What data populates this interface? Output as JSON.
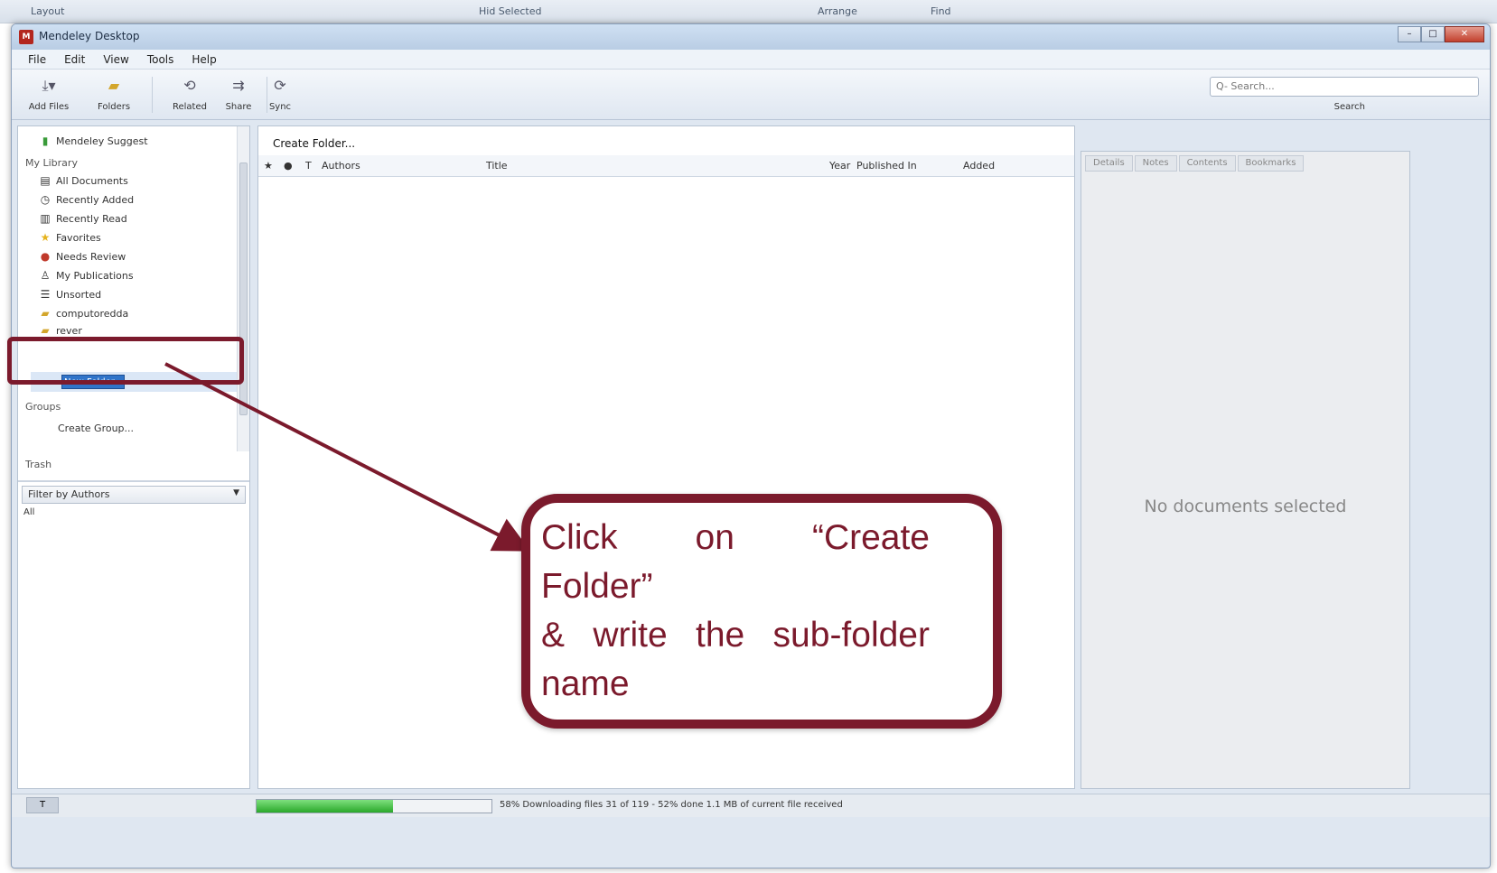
{
  "top_strip": {
    "items": [
      "Layout",
      "Hid Selected",
      "Arrange",
      "Find"
    ]
  },
  "window": {
    "title": "Mendeley Desktop",
    "icon_text": "M"
  },
  "menu": [
    "File",
    "Edit",
    "View",
    "Tools",
    "Help"
  ],
  "toolbar": {
    "buttons": [
      {
        "label": "Add Files",
        "icon": "add-files-icon"
      },
      {
        "label": "Folders",
        "icon": "folder-icon"
      },
      {
        "label": "Related",
        "icon": "related-icon"
      },
      {
        "label": "Share",
        "icon": "share-icon"
      },
      {
        "label": "Sync",
        "icon": "sync-icon"
      }
    ],
    "search_placeholder": "Q- Search...",
    "search_label": "Search"
  },
  "left_panel": {
    "mendeley_suggest": "Mendeley Suggest",
    "my_library_label": "My Library",
    "library_items": [
      {
        "label": "All Documents",
        "icon": "documents-icon"
      },
      {
        "label": "Recently Added",
        "icon": "clock-icon"
      },
      {
        "label": "Recently Read",
        "icon": "book-icon"
      },
      {
        "label": "Favorites",
        "icon": "star-icon"
      },
      {
        "label": "Needs Review",
        "icon": "review-icon"
      },
      {
        "label": "My Publications",
        "icon": "publications-icon"
      },
      {
        "label": "Unsorted",
        "icon": "unsorted-icon"
      },
      {
        "label": "computoredda",
        "icon": "folder-icon"
      },
      {
        "label": "rever",
        "icon": "folder-icon"
      }
    ],
    "new_folder_value": "New Folder",
    "groups_label": "Groups",
    "create_group": "Create Group...",
    "trash_label": "Trash",
    "filter_label": "Filter by Authors",
    "filter_all": "All"
  },
  "center_panel": {
    "create_folder": "Create Folder...",
    "columns": {
      "star": "★",
      "read": "●",
      "type": "T",
      "authors": "Authors",
      "title": "Title",
      "year": "Year",
      "published_in": "Published In",
      "added": "Added"
    }
  },
  "right_panel": {
    "tabs": [
      "Details",
      "Notes",
      "Contents",
      "Bookmarks"
    ],
    "empty_text": "No documents selected"
  },
  "status_bar": {
    "progress_fraction": 0.58,
    "text": "58%  Downloading files 31 of 119 - 52% done 1.1 MB of current file received"
  },
  "annotation": {
    "line1": "Click on “Create",
    "line2": "Folder”",
    "line3": "& write the sub-folder",
    "line4": "name",
    "color": "#7b1a2c"
  }
}
